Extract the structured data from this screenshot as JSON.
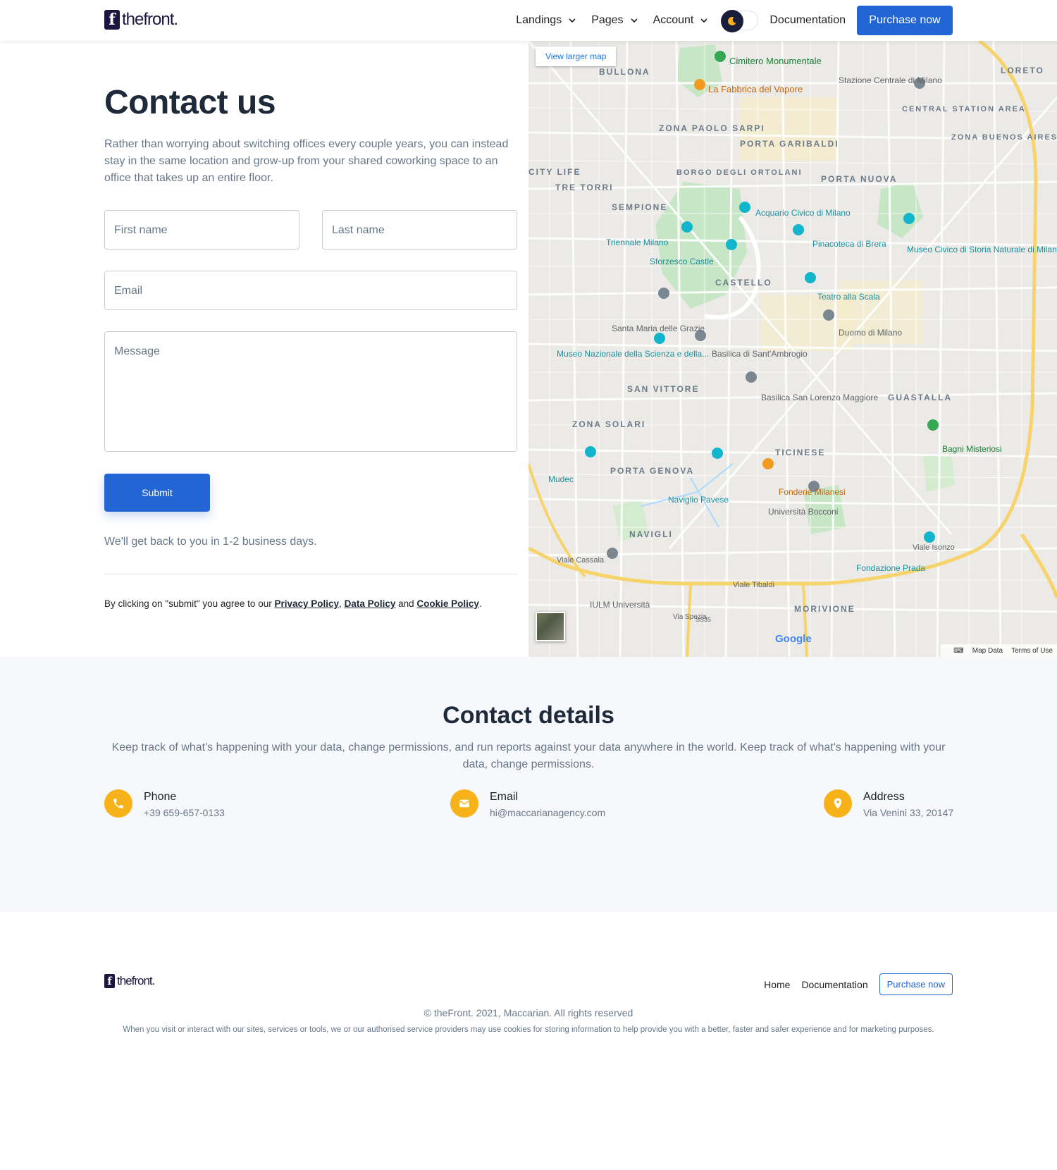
{
  "header": {
    "logo_text": "thefront.",
    "nav": [
      {
        "label": "Landings",
        "has_dropdown": true
      },
      {
        "label": "Pages",
        "has_dropdown": true
      },
      {
        "label": "Account",
        "has_dropdown": true
      }
    ],
    "theme_toggle_icon": "moon-icon",
    "documentation": "Documentation",
    "purchase": "Purchase now"
  },
  "contact": {
    "title": "Contact us",
    "lead": "Rather than worrying about switching offices every couple years, you can instead stay in the same location and grow-up from your shared coworking space to an office that takes up an entire floor.",
    "fields": {
      "first_name": "First name",
      "last_name": "Last name",
      "email": "Email",
      "message": "Message"
    },
    "submit": "Submit",
    "response_note": "We'll get back to you in 1-2 business days.",
    "agree_prefix": "By clicking on \"submit\" you agree to our",
    "privacy": "Privacy Policy",
    "comma": ",",
    "data_policy": "Data Policy",
    "and": "and",
    "cookie_policy": "Cookie Policy",
    "period": "."
  },
  "map": {
    "view_larger": "View larger map",
    "labels": [
      "Cimitero Monumentale",
      "La Fabbrica del Vapore",
      "Stazione Centrale di Milano",
      "BULLONA",
      "LORETO",
      "CENTRAL STATION AREA",
      "ZONA PAOLO SARPI",
      "PORTA GARIBALDI",
      "ZONA BUENOS AIRES",
      "BORGO DEGLI ORTOLANI",
      "CITY LIFE",
      "TRE TORRI",
      "PORTA NUOVA",
      "SEMPIONE",
      "Acquario Civico di Milano",
      "Triennale Milano",
      "Pinacoteca di Brera",
      "Museo Civico di Storia Naturale di Milano",
      "Sforzesco Castle",
      "CASTELLO",
      "Teatro alla Scala",
      "Santa Maria delle Grazie",
      "Duomo di Milano",
      "Museo Nazionale della Scienza e della...",
      "Basilica di Sant'Ambrogio",
      "SAN VITTORE",
      "GUASTALLA",
      "Basilica San Lorenzo Maggiore",
      "ZONA SOLARI",
      "TICINESE",
      "Bagni Misteriosi",
      "Mudec",
      "PORTA GENOVA",
      "Naviglio Pavese",
      "Fonderie Milanesi",
      "Università Bocconi",
      "NAVIGLI",
      "Viale Isonzo",
      "Fondazione Prada",
      "Viale Tibaldi",
      "Viale Cassala",
      "IULM Università",
      "MORIVIONE",
      "Via Spezia",
      "SS35"
    ],
    "google": "Google",
    "map_data": "Map Data",
    "terms": "Terms of Use"
  },
  "details": {
    "title": "Contact details",
    "subtitle": "Keep track of what's happening with your data, change permissions, and run reports against your data anywhere in the world. Keep track of what's happening with your data, change permissions.",
    "items": [
      {
        "icon": "phone-icon",
        "title": "Phone",
        "value": "+39 659-657-0133"
      },
      {
        "icon": "envelope-icon",
        "title": "Email",
        "value": "hi@maccarianagency.com"
      },
      {
        "icon": "map-pin-icon",
        "title": "Address",
        "value": "Via Venini 33, 20147"
      }
    ]
  },
  "footer": {
    "logo_text": "thefront.",
    "links": [
      "Home",
      "Documentation"
    ],
    "purchase": "Purchase now",
    "copyright": "© theFront. 2021, Maccarian. All rights reserved",
    "cookie_note": "When you visit or interact with our sites, services or tools, we or our authorised service providers may use cookies for storing information to help provide you with a better, faster and safer experience and for marketing purposes."
  },
  "colors": {
    "primary": "#2265d4",
    "accent_icon": "#f7b21a",
    "heading": "#1e2a3a",
    "muted": "#677788",
    "logo": "#1b1640"
  }
}
